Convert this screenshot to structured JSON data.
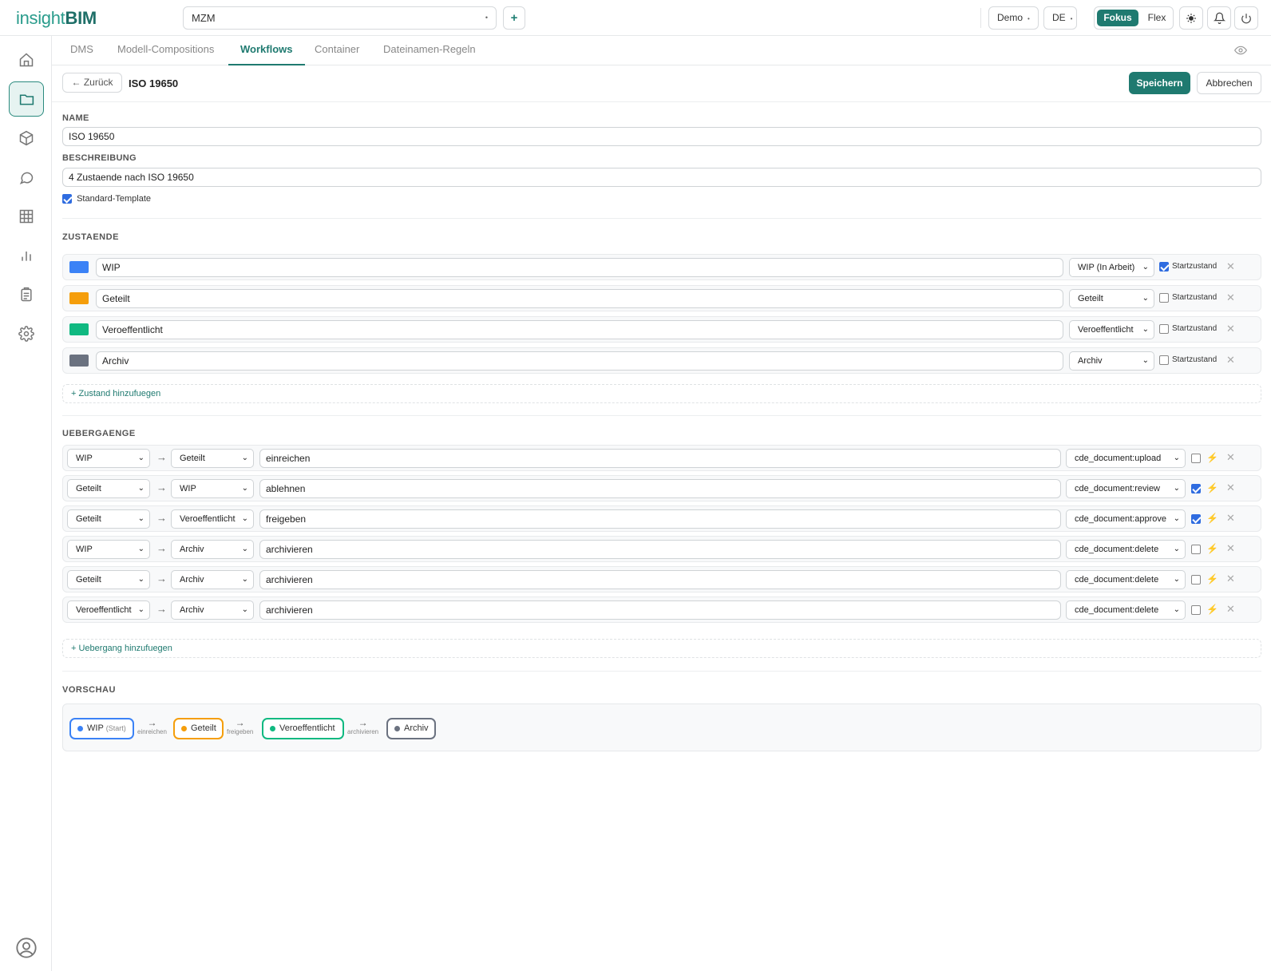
{
  "app": {
    "logo_a": "insight",
    "logo_b": "BIM"
  },
  "topbar": {
    "project": "MZM",
    "add": "+",
    "demo": "Demo",
    "lang": "DE",
    "mode_active": "Fokus",
    "mode_other": "Flex"
  },
  "tabs": [
    "DMS",
    "Modell-Compositions",
    "Workflows",
    "Container",
    "Dateinamen-Regeln"
  ],
  "header": {
    "back": "← Zurück",
    "title": "ISO 19650",
    "save": "Speichern",
    "cancel": "Abbrechen"
  },
  "form": {
    "name_label": "NAME",
    "name_value": "ISO 19650",
    "desc_label": "BESCHREIBUNG",
    "desc_value": "4 Zustaende nach ISO 19650",
    "std_template": "Standard-Template",
    "std_checked": true
  },
  "states_section": {
    "title": "ZUSTAENDE",
    "start_label": "Startzustand",
    "add": "+ Zustand hinzufuegen",
    "items": [
      {
        "name": "WIP",
        "color": "#3b82f6",
        "type": "WIP (In Arbeit)",
        "start": true
      },
      {
        "name": "Geteilt",
        "color": "#f59e0b",
        "type": "Geteilt",
        "start": false
      },
      {
        "name": "Veroeffentlicht",
        "color": "#10b981",
        "type": "Veroeffentlicht",
        "start": false
      },
      {
        "name": "Archiv",
        "color": "#6b7280",
        "type": "Archiv",
        "start": false
      }
    ]
  },
  "transitions_section": {
    "title": "UEBERGAENGE",
    "add": "+ Uebergang hinzufuegen",
    "items": [
      {
        "from": "WIP",
        "to": "Geteilt",
        "action": "einreichen",
        "perm": "cde_document:upload",
        "checked": false
      },
      {
        "from": "Geteilt",
        "to": "WIP",
        "action": "ablehnen",
        "perm": "cde_document:review",
        "checked": true
      },
      {
        "from": "Geteilt",
        "to": "Veroeffentlicht",
        "action": "freigeben",
        "perm": "cde_document:approve",
        "checked": true
      },
      {
        "from": "WIP",
        "to": "Archiv",
        "action": "archivieren",
        "perm": "cde_document:delete",
        "checked": false
      },
      {
        "from": "Geteilt",
        "to": "Archiv",
        "action": "archivieren",
        "perm": "cde_document:delete",
        "checked": false
      },
      {
        "from": "Veroeffentlicht",
        "to": "Archiv",
        "action": "archivieren",
        "perm": "cde_document:delete",
        "checked": false
      }
    ]
  },
  "preview": {
    "title": "VORSCHAU",
    "start_tag": "(Start)",
    "chips": [
      {
        "label": "WIP",
        "color": "#3b82f6"
      },
      {
        "label": "Geteilt",
        "color": "#f59e0b"
      },
      {
        "label": "Veroeffentlicht",
        "color": "#10b981"
      },
      {
        "label": "Archiv",
        "color": "#6b7280"
      }
    ],
    "connectors": [
      "einreichen",
      "freigeben",
      "archivieren"
    ]
  },
  "icons": {
    "sidebar": [
      "home-icon",
      "folder-icon",
      "cube-icon",
      "chat-icon",
      "grid-icon",
      "chart-icon",
      "clipboard-icon",
      "settings-icon"
    ],
    "topbar": [
      "sun-icon",
      "bell-icon",
      "power-icon"
    ],
    "other": [
      "eye-icon",
      "user-icon",
      "close-icon",
      "bolt-icon"
    ]
  },
  "colors": {
    "accent": "#1f7a70"
  }
}
